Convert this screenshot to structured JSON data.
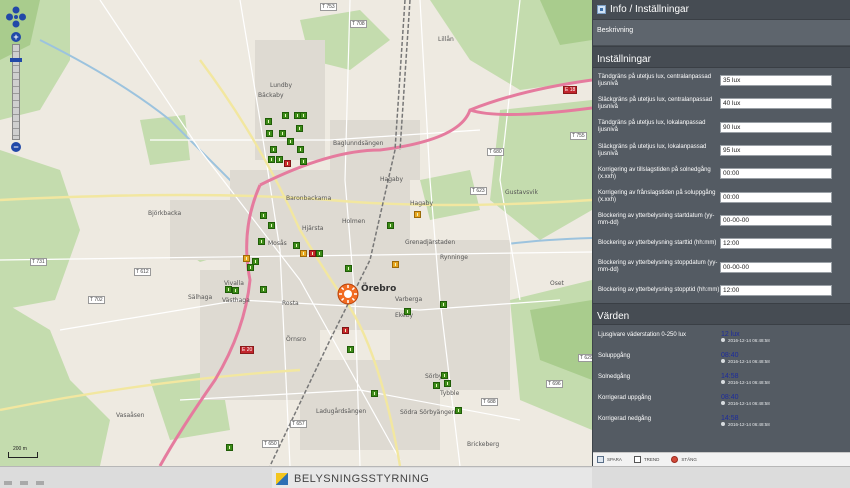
{
  "map": {
    "place_labels": [
      "Lundby",
      "Bäckaby",
      "Björkbacka",
      "Baronbackarna",
      "Hjärsta",
      "Holmen",
      "Grenadjärstaden",
      "Rynninge",
      "Örebro",
      "Vivalla",
      "Sörby",
      "Tybble",
      "Ladugårdsängen",
      "Brickeberg",
      "Varberga",
      "Hagaby",
      "Lillån",
      "Rosta",
      "Västhaga",
      "Sälhaga",
      "Mosås",
      "Örnsro",
      "Ekeby",
      "Baglunndsängen",
      "Hagaby",
      "Oset",
      "Gustavsvik",
      "Södra Sörbyängen",
      "Vasaåsen"
    ],
    "road_numbers": [
      "T 753",
      "T 708",
      "T 702",
      "T 731",
      "E 18",
      "E 20",
      "T 623",
      "T 680",
      "T 755",
      "T 696",
      "T 629",
      "T 657",
      "T 688",
      "T 650",
      "T 612"
    ],
    "station_name": "Örebro",
    "scale_label": "200 m",
    "zoom_plus": "+",
    "zoom_minus": "−"
  },
  "panel": {
    "title": "Info / Inställningar",
    "description": "Beskrivning",
    "settings_title": "Inställningar",
    "settings": [
      {
        "label": "Tändgräns på utetjus lux, centralanpassad ljusnivå",
        "value": "35 lux"
      },
      {
        "label": "Släckgräns på utetjus lux, centralanpassad ljusnivå",
        "value": "40 lux"
      },
      {
        "label": "Tändgräns på utetjus lux, lokalanpassad ljusnivå",
        "value": "90 lux"
      },
      {
        "label": "Släckgräns på utetjus lux, lokalanpassad ljusnivå",
        "value": "95 lux"
      },
      {
        "label": "Korrigering av tillslagstiden på solnedgång (x.xxh)",
        "value": "00:00"
      },
      {
        "label": "Korrigering av frånslagstiden på soluppgång (x.xxh)",
        "value": "00:00"
      },
      {
        "label": "Blockering av ytterbelysning startdatum (yy-mm-dd)",
        "value": "00-00-00"
      },
      {
        "label": "Blockering av ytterbelysning starttid (hh:mm)",
        "value": "12:00"
      },
      {
        "label": "Blockering av ytterbelysning stoppdatum (yy-mm-dd)",
        "value": "00-00-00"
      },
      {
        "label": "Blockering av ytterbelysning stopptid (hh:mm)",
        "value": "12:00"
      }
    ],
    "values_title": "Värden",
    "values": [
      {
        "label": "Ljusgivare väderstation 0-250 lux",
        "value": "12 lux",
        "timestamp": "2016-12-14 06:48:58"
      },
      {
        "label": "Soluppgång",
        "value": "08:40",
        "timestamp": "2016-12-14 06:48:58"
      },
      {
        "label": "Solnedgång",
        "value": "14:58",
        "timestamp": "2016-12-14 06:48:58"
      },
      {
        "label": "Korrigerad uppgång",
        "value": "08:40",
        "timestamp": "2016-12-14 06:48:58"
      },
      {
        "label": "Korrigerad nedgång",
        "value": "14:58",
        "timestamp": "2016-12-14 06:48:58"
      }
    ],
    "toolbar": {
      "save": "SPARA",
      "trend": "TREND",
      "close": "STÄNG"
    }
  },
  "footer": {
    "title": "BELYSNINGSSTYRNING"
  },
  "colors": {
    "panel_bg": "#545b63",
    "lamp_green": "#3b8a17",
    "lamp_red": "#c8282b",
    "lamp_orange": "#e8a521",
    "value_blue": "#1d2c9c"
  }
}
